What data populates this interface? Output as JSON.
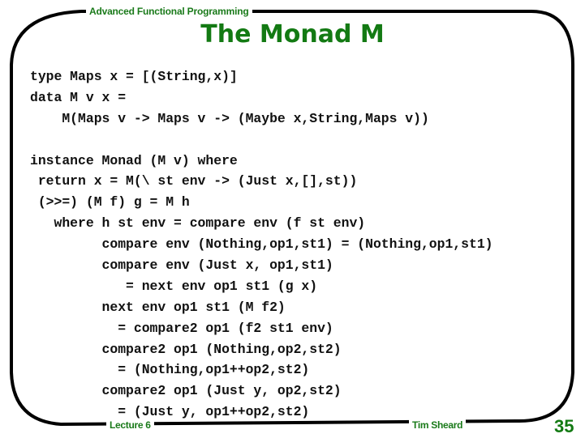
{
  "header": {
    "course_title": "Advanced Functional Programming",
    "slide_title": "The Monad M"
  },
  "code": {
    "block1": [
      "type Maps x = [(String,x)]",
      "data M v x =",
      "    M(Maps v -> Maps v -> (Maybe x,String,Maps v))"
    ],
    "block2": [
      "instance Monad (M v) where",
      " return x = M(\\ st env -> (Just x,[],st))",
      " (>>=) (M f) g = M h",
      "   where h st env = compare env (f st env)",
      "         compare env (Nothing,op1,st1) = (Nothing,op1,st1)",
      "         compare env (Just x, op1,st1)",
      "            = next env op1 st1 (g x)",
      "         next env op1 st1 (M f2)",
      "           = compare2 op1 (f2 st1 env)",
      "         compare2 op1 (Nothing,op2,st2)",
      "           = (Nothing,op1++op2,st2)",
      "         compare2 op1 (Just y, op2,st2)",
      "           = (Just y, op1++op2,st2)"
    ]
  },
  "footer": {
    "lecture": "Lecture 6",
    "author": "Tim Sheard",
    "page_number": "35"
  },
  "colors": {
    "accent_green": "#137a13",
    "frame": "#000000",
    "text": "#111111"
  }
}
